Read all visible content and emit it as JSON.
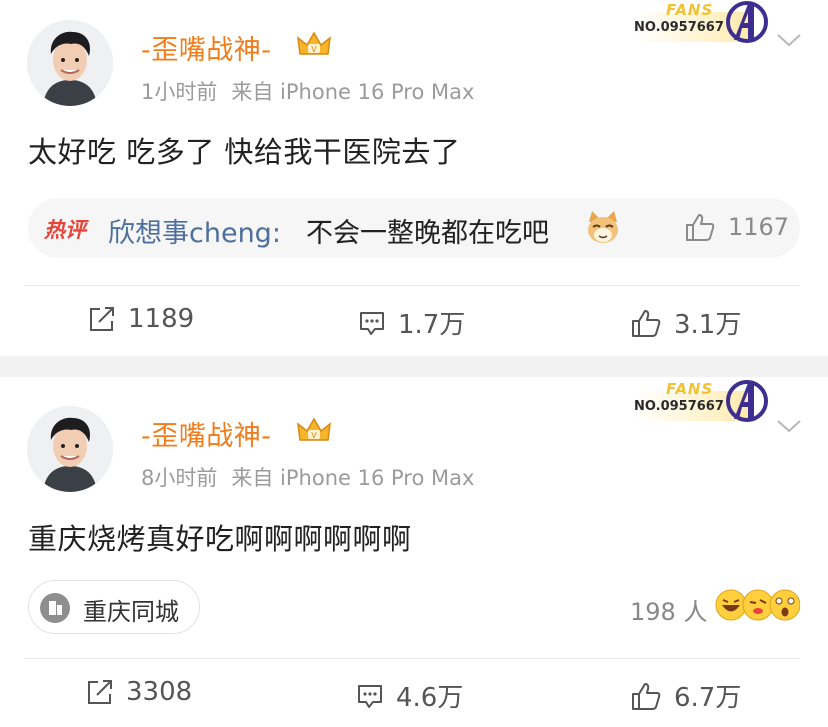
{
  "posts": [
    {
      "username": "-歪嘴战神-",
      "time": "1小时前",
      "source": "来自 iPhone 16 Pro Max",
      "fans_label": "FANS",
      "fans_no": "NO.0957667",
      "text": "太好吃 吃多了 快给我干医院去了",
      "hot_comment": {
        "badge": "热评",
        "user": "欣想事cheng:",
        "text": "不会一整晚都在吃吧",
        "likes": "1167"
      },
      "reposts": "1189",
      "comments": "1.7万",
      "likes": "3.1万"
    },
    {
      "username": "-歪嘴战神-",
      "time": "8小时前",
      "source": "来自 iPhone 16 Pro Max",
      "fans_label": "FANS",
      "fans_no": "NO.0957667",
      "text": "重庆烧烤真好吃啊啊啊啊啊啊",
      "location": "重庆同城",
      "reactors": "198 人",
      "reposts": "3308",
      "comments": "4.6万",
      "likes": "6.7万"
    }
  ],
  "colors": {
    "username": "#f07c1a",
    "link_blue": "#4d6f9c",
    "hot_red": "#e8443a",
    "meta_gray": "#9b9b9b",
    "separator": "#f2f2f2"
  }
}
